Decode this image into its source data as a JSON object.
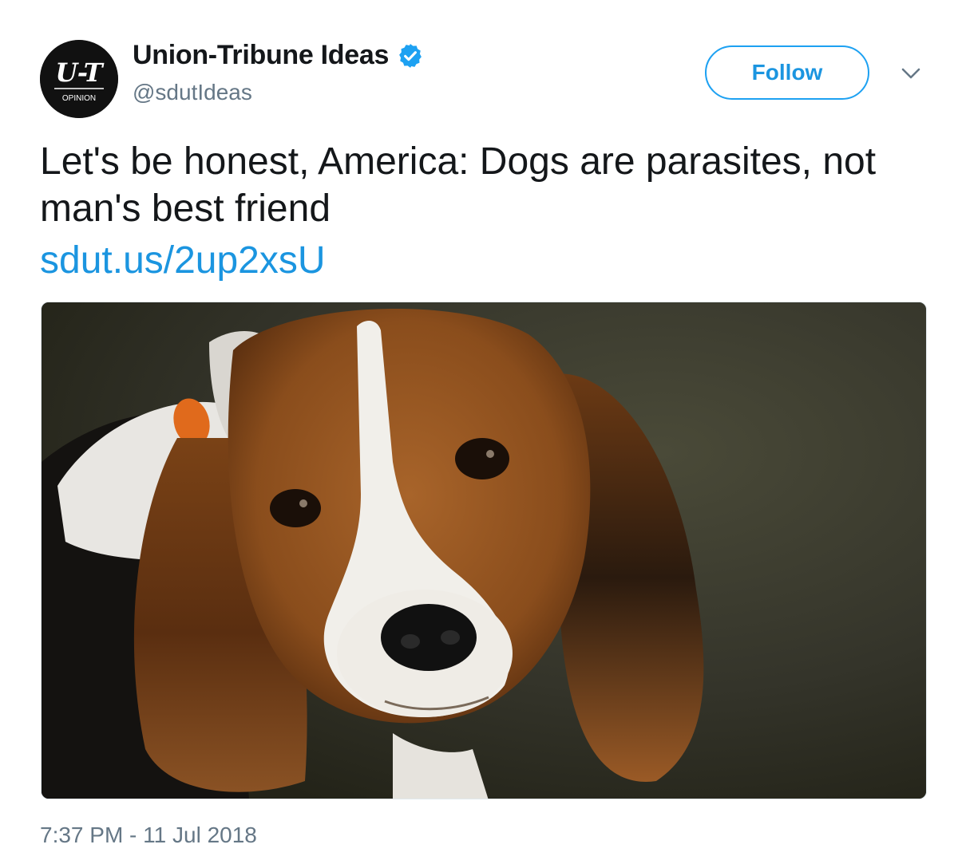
{
  "account": {
    "avatar_logo_text": "U-T",
    "avatar_caption": "OPINION",
    "display_name": "Union-Tribune Ideas",
    "verified_icon": "verified-badge-icon",
    "handle": "@sdutIdeas"
  },
  "actions": {
    "follow_label": "Follow",
    "menu_icon": "chevron-down-icon"
  },
  "tweet": {
    "text": "Let's be honest, America: Dogs are parasites, not man's best friend",
    "link": "sdut.us/2up2xsU",
    "photo_subject": "beagle puppy",
    "timestamp": "7:37 PM - 11 Jul 2018"
  },
  "colors": {
    "accent": "#1b95e0",
    "follow_border": "#1da1f2",
    "secondary_text": "#657786",
    "primary_text": "#14171a"
  }
}
